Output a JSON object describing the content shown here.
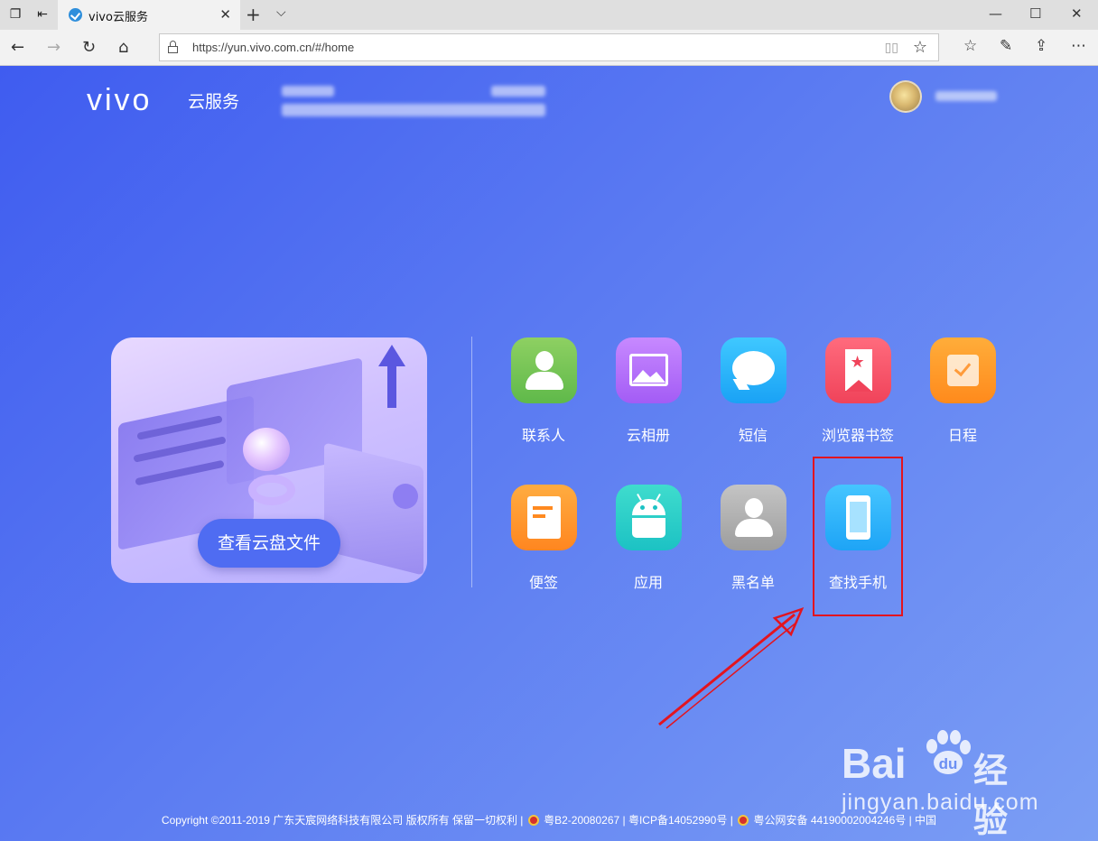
{
  "browser": {
    "tab_title": "vivo云服务",
    "url": "https://yun.vivo.com.cn/#/home",
    "icons": [
      "tab-switcher-icon",
      "set-aside-tabs-icon",
      "new-tab-icon",
      "tab-list-icon",
      "minimize-icon",
      "maximize-icon",
      "close-icon",
      "back-icon",
      "forward-icon",
      "refresh-icon",
      "home-icon",
      "lock-icon",
      "reading-view-icon",
      "favorite-star-icon",
      "favorites-icon",
      "pen-icon",
      "share-icon",
      "more-icon"
    ]
  },
  "header": {
    "logo": "vivo",
    "logo_sub": "云服务"
  },
  "banner": {
    "button_label": "查看云盘文件"
  },
  "apps": [
    {
      "label": "联系人",
      "icon": "contacts-icon"
    },
    {
      "label": "云相册",
      "icon": "cloud-album-icon"
    },
    {
      "label": "短信",
      "icon": "sms-icon"
    },
    {
      "label": "浏览器书签",
      "icon": "browser-bookmark-icon"
    },
    {
      "label": "日程",
      "icon": "schedule-icon"
    },
    {
      "label": "便签",
      "icon": "notes-icon"
    },
    {
      "label": "应用",
      "icon": "apps-icon"
    },
    {
      "label": "黑名单",
      "icon": "blacklist-icon"
    },
    {
      "label": "查找手机",
      "icon": "find-phone-icon"
    }
  ],
  "annotation": {
    "highlight_color": "#e3141f"
  },
  "watermark": {
    "bai": "Bai",
    "du": "du",
    "jingyan": "经验",
    "domain": "jingyan.baidu.com"
  },
  "footer": {
    "copyright": "Copyright ©2011-2019 广东天宸网络科技有限公司 版权所有 保留一切权利 |",
    "license1": "粤B2-20080267 | 粤ICP备14052990号 |",
    "license2": "粤公网安备 44190002004246号 | 中国"
  },
  "colors": {
    "page_gradient_start": "#3f5cf0",
    "page_gradient_end": "#7b9ef4",
    "button_blue": "#4f6cf2"
  }
}
